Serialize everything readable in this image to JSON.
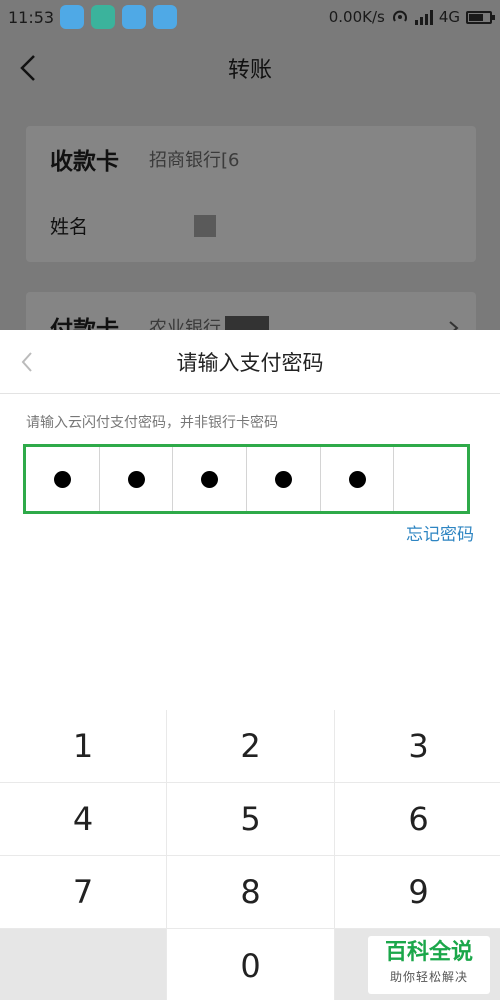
{
  "status_bar": {
    "time": "11:53",
    "speed": "0.00K/s",
    "network": "4G"
  },
  "page": {
    "title": "转账",
    "payee_label": "收款卡",
    "payee_bank": "招商银行[6",
    "name_label": "姓名",
    "payer_label": "付款卡",
    "payer_bank": "农业银行"
  },
  "modal": {
    "title": "请输入支付密码",
    "hint": "请输入云闪付支付密码，并非银行卡密码",
    "pin": {
      "length": 6,
      "filled": 5,
      "box_color": "#2eaa49"
    },
    "forgot": "忘记密码"
  },
  "keypad": {
    "keys": [
      "1",
      "2",
      "3",
      "4",
      "5",
      "6",
      "7",
      "8",
      "9",
      "",
      "0",
      ""
    ]
  },
  "watermark": {
    "title": "百科全说",
    "subtitle": "助你轻松解决"
  }
}
